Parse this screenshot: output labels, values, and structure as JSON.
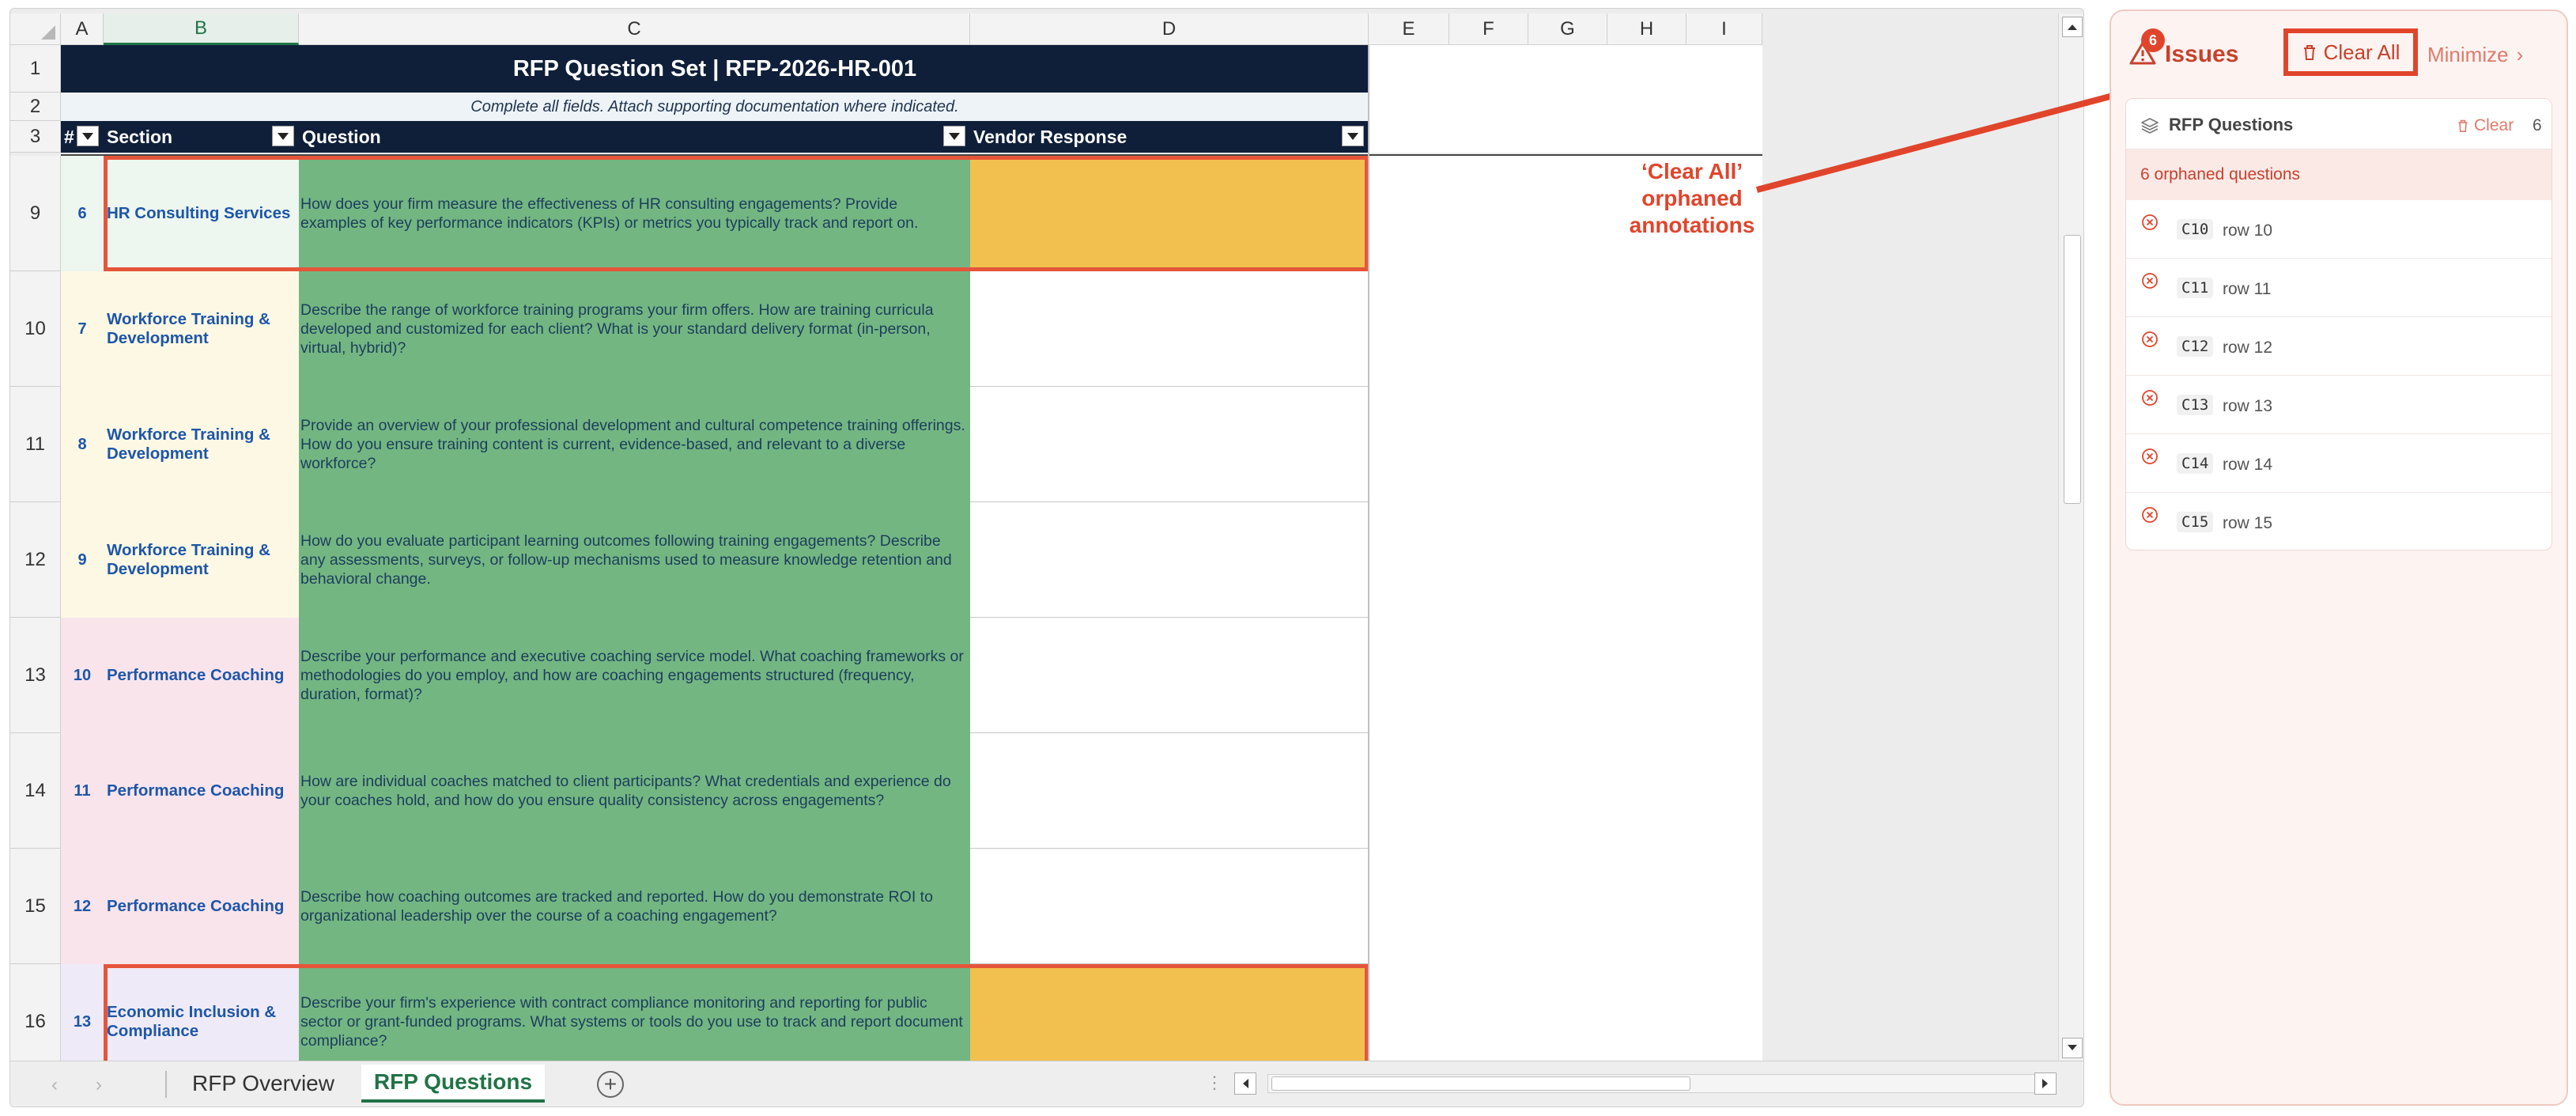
{
  "spreadsheet": {
    "columns": [
      "A",
      "B",
      "C",
      "D",
      "E",
      "F",
      "G",
      "H",
      "I"
    ],
    "selected_column": "B",
    "header_rows": [
      {
        "row": "1",
        "title": "RFP Question Set  |  RFP-2026-HR-001"
      },
      {
        "row": "2",
        "subtitle": "Complete all fields. Attach supporting documentation where indicated."
      },
      {
        "row": "3",
        "headers": [
          "#",
          "Section",
          "Question",
          "Vendor Response"
        ]
      }
    ],
    "rows": [
      {
        "row": "9",
        "num": "6",
        "section": "HR Consulting Services",
        "section_group": "hr",
        "flagged": true,
        "question": "How does your firm measure the effectiveness of HR consulting engagements? Provide examples of key performance indicators (KPIs) or metrics you typically track and report on."
      },
      {
        "row": "10",
        "num": "7",
        "section": "Workforce Training & Development",
        "section_group": "train",
        "flagged": false,
        "question": "Describe the range of workforce training programs your firm offers. How are training curricula developed and customized for each client? What is your standard delivery format (in-person, virtual, hybrid)?"
      },
      {
        "row": "11",
        "num": "8",
        "section": "Workforce Training & Development",
        "section_group": "train",
        "flagged": false,
        "question": "Provide an overview of your professional development and cultural competence training offerings. How do you ensure training content is current, evidence-based, and relevant to a diverse workforce?"
      },
      {
        "row": "12",
        "num": "9",
        "section": "Workforce Training & Development",
        "section_group": "train",
        "flagged": false,
        "question": "How do you evaluate participant learning outcomes following training engagements? Describe any assessments, surveys, or follow-up mechanisms used to measure knowledge retention and behavioral change."
      },
      {
        "row": "13",
        "num": "10",
        "section": "Performance Coaching",
        "section_group": "perf",
        "flagged": false,
        "question": "Describe your performance and executive coaching service model. What coaching frameworks or methodologies do you employ, and how are coaching engagements structured (frequency, duration, format)?"
      },
      {
        "row": "14",
        "num": "11",
        "section": "Performance Coaching",
        "section_group": "perf",
        "flagged": false,
        "question": "How are individual coaches matched to client participants? What credentials and experience do your coaches hold, and how do you ensure quality consistency across engagements?"
      },
      {
        "row": "15",
        "num": "12",
        "section": "Performance Coaching",
        "section_group": "perf",
        "flagged": false,
        "question": "Describe how coaching outcomes are tracked and reported. How do you demonstrate ROI to organizational leadership over the course of a coaching engagement?"
      },
      {
        "row": "16",
        "num": "13",
        "section": "Economic Inclusion & Compliance",
        "section_group": "econ",
        "flagged": true,
        "question": "Describe your firm's experience with contract compliance monitoring and reporting for public sector or grant-funded programs. What systems or tools do you use to track and report document compliance?"
      }
    ],
    "sheet_tabs": [
      {
        "label": "RFP Overview",
        "active": false
      },
      {
        "label": "RFP Questions",
        "active": true
      }
    ]
  },
  "annotation": {
    "callout_lines": [
      "‘Clear All’",
      "orphaned",
      "annotations"
    ],
    "color": "#e0452c"
  },
  "issues_panel": {
    "count": "6",
    "title": "Issues",
    "clear_all_label": "Clear All",
    "minimize_label": "Minimize",
    "card": {
      "title": "RFP Questions",
      "clear_label": "Clear",
      "count": "6",
      "banner": "6 orphaned questions",
      "items": [
        {
          "cell": "C10",
          "label": "row 10"
        },
        {
          "cell": "C11",
          "label": "row 11"
        },
        {
          "cell": "C12",
          "label": "row 12"
        },
        {
          "cell": "C13",
          "label": "row 13"
        },
        {
          "cell": "C14",
          "label": "row 14"
        },
        {
          "cell": "C15",
          "label": "row 15"
        }
      ]
    }
  },
  "colors": {
    "header_navy": "#0f1f3a",
    "question_green": "#73b682",
    "flag_yellow": "#f2c04e",
    "accent_red": "#e0452c",
    "excel_green": "#217346"
  }
}
